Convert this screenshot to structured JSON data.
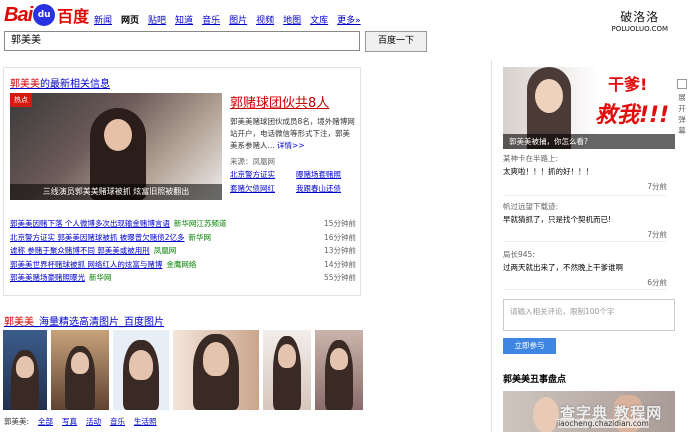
{
  "header": {
    "logo_bai": "Bai",
    "logo_du": "du",
    "logo_cn": "百度",
    "nav": [
      {
        "label": "新闻",
        "current": false
      },
      {
        "label": "网页",
        "current": true
      },
      {
        "label": "贴吧",
        "current": false
      },
      {
        "label": "知道",
        "current": false
      },
      {
        "label": "音乐",
        "current": false
      },
      {
        "label": "图片",
        "current": false
      },
      {
        "label": "视频",
        "current": false
      },
      {
        "label": "地图",
        "current": false
      },
      {
        "label": "文库",
        "current": false
      },
      {
        "label": "更多»",
        "current": false
      }
    ],
    "brand_cn": "破洛洛",
    "brand_en": "POLUOLUO.COM"
  },
  "search": {
    "query": "郭美美",
    "button_label": "百度一下"
  },
  "news": {
    "title_keyword": "郭美美",
    "title_rest": "的最新相关信息",
    "hot_tag": "热点",
    "image_caption": "三线演员郭美美赌球被抓 炫富旧照被翻出",
    "headline": "郭赌球团伙共8人",
    "desc_text": "郭美美赌球团伙成员8名，境外赌博网站开户，电话微信等形式下注，郭美美系参赌人...",
    "desc_link": "详情>>",
    "source": "来源：凤凰网",
    "related": [
      "北京警方证实",
      "曝赌场套赌照",
      "套赌欠债网红",
      "我跟春山还债"
    ],
    "items": [
      {
        "title": "郭美美因赌下落 个人微博多次出现输金赌博言语",
        "source": "新华网江苏频道",
        "time": "15分钟前"
      },
      {
        "title": "北京警方证实 郭美美因赌球被抓 被曝曾欠赌债2亿多",
        "source": "新华网",
        "time": "16分钟前"
      },
      {
        "title": "谑称 参赌于聚众赌博不同 郭美美或被用刑",
        "source": "凤凰网",
        "time": "13分钟前"
      },
      {
        "title": "郭美美世界杯赌球被抓 网络红人的炫富与赌博",
        "source": "金鹰网络",
        "time": "14分钟前"
      },
      {
        "title": "郭美美赌场豪赌照曝光",
        "source": "新华网",
        "time": "55分钟前"
      }
    ]
  },
  "images": {
    "title_keyword": "郭美美",
    "title_rest": "_海量精选高清图片_百度图片",
    "nav_prefix": "郭美美:",
    "nav": [
      "全部",
      "写真",
      "活动",
      "音乐",
      "生活照"
    ]
  },
  "sidebar": {
    "banner_t1": "干爹!",
    "banner_t2": "救我!!!",
    "banner_caption": "郭美美被捕，你怎么看?",
    "share_label": "展开弹幕",
    "comments": [
      {
        "user": "某神卡在半路上:",
        "text": "太爽啦！！！抓的好！！！",
        "time": "7分前"
      },
      {
        "user": "帆过远望下载迹:",
        "text": "早就猜抓了，只是找个契机而已!",
        "time": "7分前"
      },
      {
        "user": "局长945:",
        "text": "过两天就出来了，不然晚上干爹谁啊",
        "time": "6分前"
      }
    ],
    "input_placeholder": "请输入相关评论，限制100个字",
    "submit_label": "立即参与",
    "hot_title": "郭美美丑事盘点",
    "watermark": "查字典 教程网",
    "watermark_url": "jiaocheng.chazidian.com"
  }
}
